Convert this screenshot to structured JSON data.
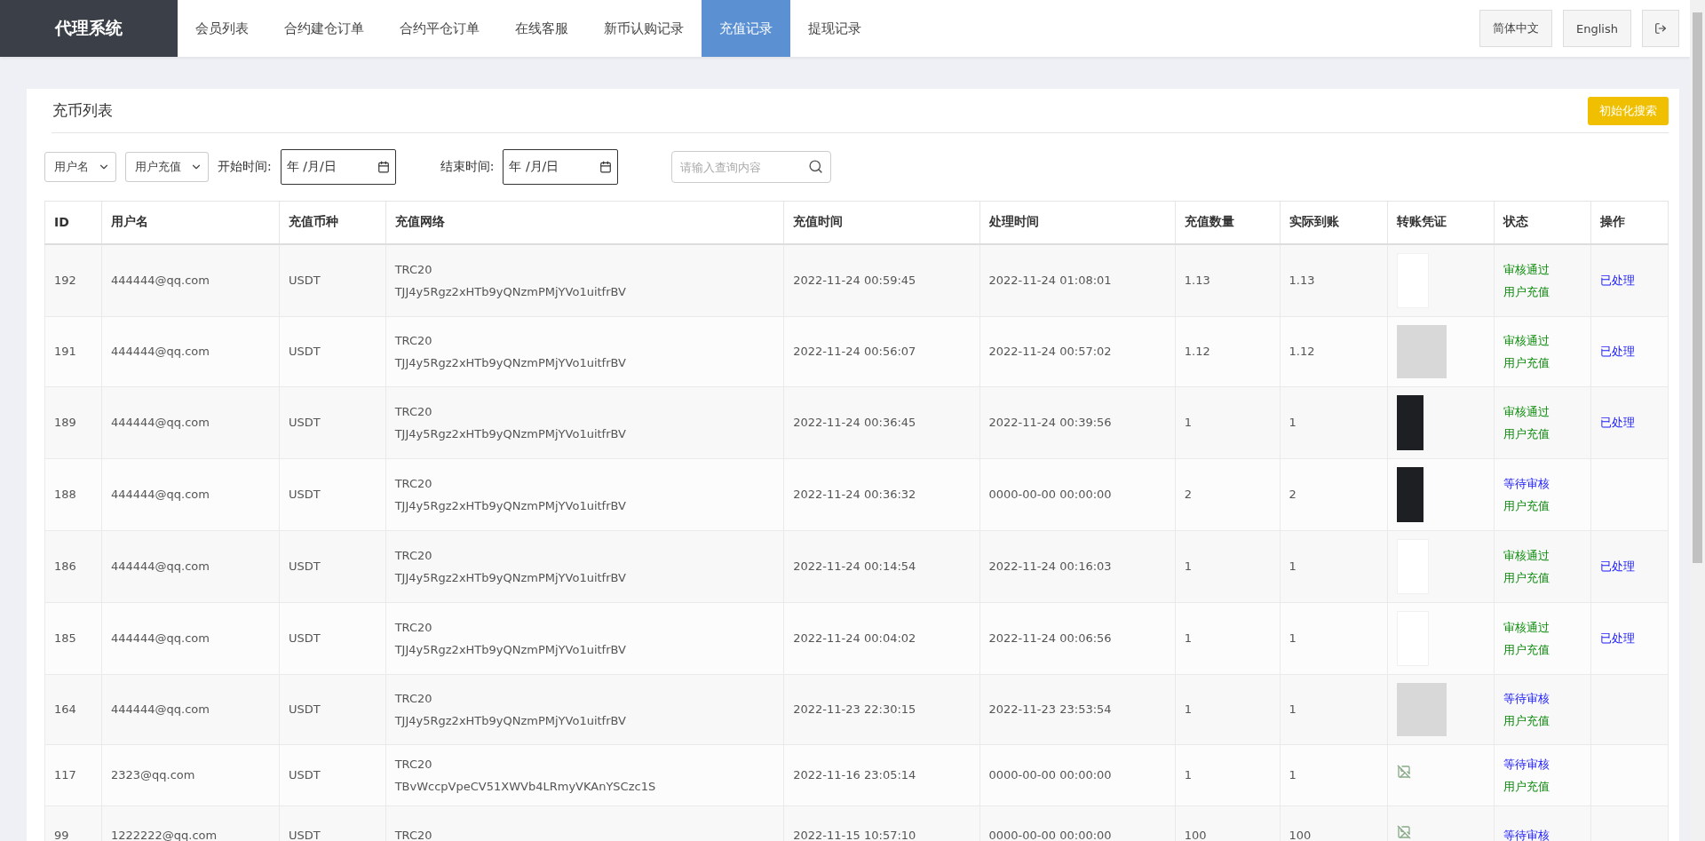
{
  "brand": "代理系统",
  "nav": [
    {
      "label": "会员列表",
      "selected": false
    },
    {
      "label": "合约建仓订单",
      "selected": false
    },
    {
      "label": "合约平仓订单",
      "selected": false
    },
    {
      "label": "在线客服",
      "selected": false
    },
    {
      "label": "新币认购记录",
      "selected": false
    },
    {
      "label": "充值记录",
      "selected": true
    },
    {
      "label": "提现记录",
      "selected": false
    }
  ],
  "languages": [
    "简体中文",
    "English"
  ],
  "card": {
    "title": "充币列表",
    "reset_button": "初始化搜索"
  },
  "filters": {
    "selects": [
      "用户名",
      "用户充值"
    ],
    "start": {
      "label": "开始时间:",
      "placeholder": "年 /月/日"
    },
    "end": {
      "label": "结束时间:",
      "placeholder": "年 /月/日"
    },
    "search": {
      "placeholder": "请输入查询内容"
    }
  },
  "table": {
    "columns": [
      "ID",
      "用户名",
      "充值币种",
      "充值网络",
      "充值时间",
      "处理时间",
      "充值数量",
      "实际到账",
      "转账凭证",
      "状态",
      "操作"
    ],
    "rows": [
      {
        "id": "192",
        "user": "444444@qq.com",
        "coin": "USDT",
        "network": [
          "TRC20",
          "TJJ4y5Rgz2xHTb9yQNzmPMjYVo1uitfrBV"
        ],
        "time": "2022-11-24 00:59:45",
        "processed": "2022-11-24 01:08:01",
        "amount": "1.13",
        "received": "1.13",
        "proof": {
          "kind": "light"
        },
        "status": [
          {
            "kind": "approved",
            "text": "审核通过"
          },
          {
            "kind": "type",
            "text": "用户充值"
          }
        ],
        "action": "已处理"
      },
      {
        "id": "191",
        "user": "444444@qq.com",
        "coin": "USDT",
        "network": [
          "TRC20",
          "TJJ4y5Rgz2xHTb9yQNzmPMjYVo1uitfrBV"
        ],
        "time": "2022-11-24 00:56:07",
        "processed": "2022-11-24 00:57:02",
        "amount": "1.12",
        "received": "1.12",
        "proof": {
          "kind": "photo"
        },
        "status": [
          {
            "kind": "approved",
            "text": "审核通过"
          },
          {
            "kind": "type",
            "text": "用户充值"
          }
        ],
        "action": "已处理"
      },
      {
        "id": "189",
        "user": "444444@qq.com",
        "coin": "USDT",
        "network": [
          "TRC20",
          "TJJ4y5Rgz2xHTb9yQNzmPMjYVo1uitfrBV"
        ],
        "time": "2022-11-24 00:36:45",
        "processed": "2022-11-24 00:39:56",
        "amount": "1",
        "received": "1",
        "proof": {
          "kind": "dark"
        },
        "status": [
          {
            "kind": "approved",
            "text": "审核通过"
          },
          {
            "kind": "type",
            "text": "用户充值"
          }
        ],
        "action": "已处理"
      },
      {
        "id": "188",
        "user": "444444@qq.com",
        "coin": "USDT",
        "network": [
          "TRC20",
          "TJJ4y5Rgz2xHTb9yQNzmPMjYVo1uitfrBV"
        ],
        "time": "2022-11-24 00:36:32",
        "processed": "0000-00-00 00:00:00",
        "amount": "2",
        "received": "2",
        "proof": {
          "kind": "dark"
        },
        "status": [
          {
            "kind": "pending",
            "text": "等待审核"
          },
          {
            "kind": "type",
            "text": "用户充值"
          }
        ]
      },
      {
        "id": "186",
        "user": "444444@qq.com",
        "coin": "USDT",
        "network": [
          "TRC20",
          "TJJ4y5Rgz2xHTb9yQNzmPMjYVo1uitfrBV"
        ],
        "time": "2022-11-24 00:14:54",
        "processed": "2022-11-24 00:16:03",
        "amount": "1",
        "received": "1",
        "proof": {
          "kind": "light"
        },
        "status": [
          {
            "kind": "approved",
            "text": "审核通过"
          },
          {
            "kind": "type",
            "text": "用户充值"
          }
        ],
        "action": "已处理"
      },
      {
        "id": "185",
        "user": "444444@qq.com",
        "coin": "USDT",
        "network": [
          "TRC20",
          "TJJ4y5Rgz2xHTb9yQNzmPMjYVo1uitfrBV"
        ],
        "time": "2022-11-24 00:04:02",
        "processed": "2022-11-24 00:06:56",
        "amount": "1",
        "received": "1",
        "proof": {
          "kind": "light"
        },
        "status": [
          {
            "kind": "approved",
            "text": "审核通过"
          },
          {
            "kind": "type",
            "text": "用户充值"
          }
        ],
        "action": "已处理"
      },
      {
        "id": "164",
        "user": "444444@qq.com",
        "coin": "USDT",
        "network": [
          "TRC20",
          "TJJ4y5Rgz2xHTb9yQNzmPMjYVo1uitfrBV"
        ],
        "time": "2022-11-23 22:30:15",
        "processed": "2022-11-23 23:53:54",
        "amount": "1",
        "received": "1",
        "proof": {
          "kind": "photo"
        },
        "status": [
          {
            "kind": "pending",
            "text": "等待审核"
          },
          {
            "kind": "type",
            "text": "用户充值"
          }
        ]
      },
      {
        "id": "117",
        "user": "2323@qq.com",
        "coin": "USDT",
        "network": [
          "TRC20",
          "TBvWccpVpeCV51XWVb4LRmyVKAnYSCzc1S"
        ],
        "time": "2022-11-16 23:05:14",
        "processed": "0000-00-00 00:00:00",
        "amount": "1",
        "received": "1",
        "proof": {
          "kind": "broken"
        },
        "status": [
          {
            "kind": "pending",
            "text": "等待审核"
          },
          {
            "kind": "type",
            "text": "用户充值"
          }
        ]
      },
      {
        "id": "99",
        "user": "1222222@qq.com",
        "coin": "USDT",
        "network": [
          "TRC20"
        ],
        "time": "2022-11-15 10:57:10",
        "processed": "0000-00-00 00:00:00",
        "amount": "100",
        "received": "100",
        "proof": {
          "kind": "broken"
        },
        "status": [
          {
            "kind": "pending",
            "text": "等待审核"
          }
        ]
      }
    ]
  }
}
